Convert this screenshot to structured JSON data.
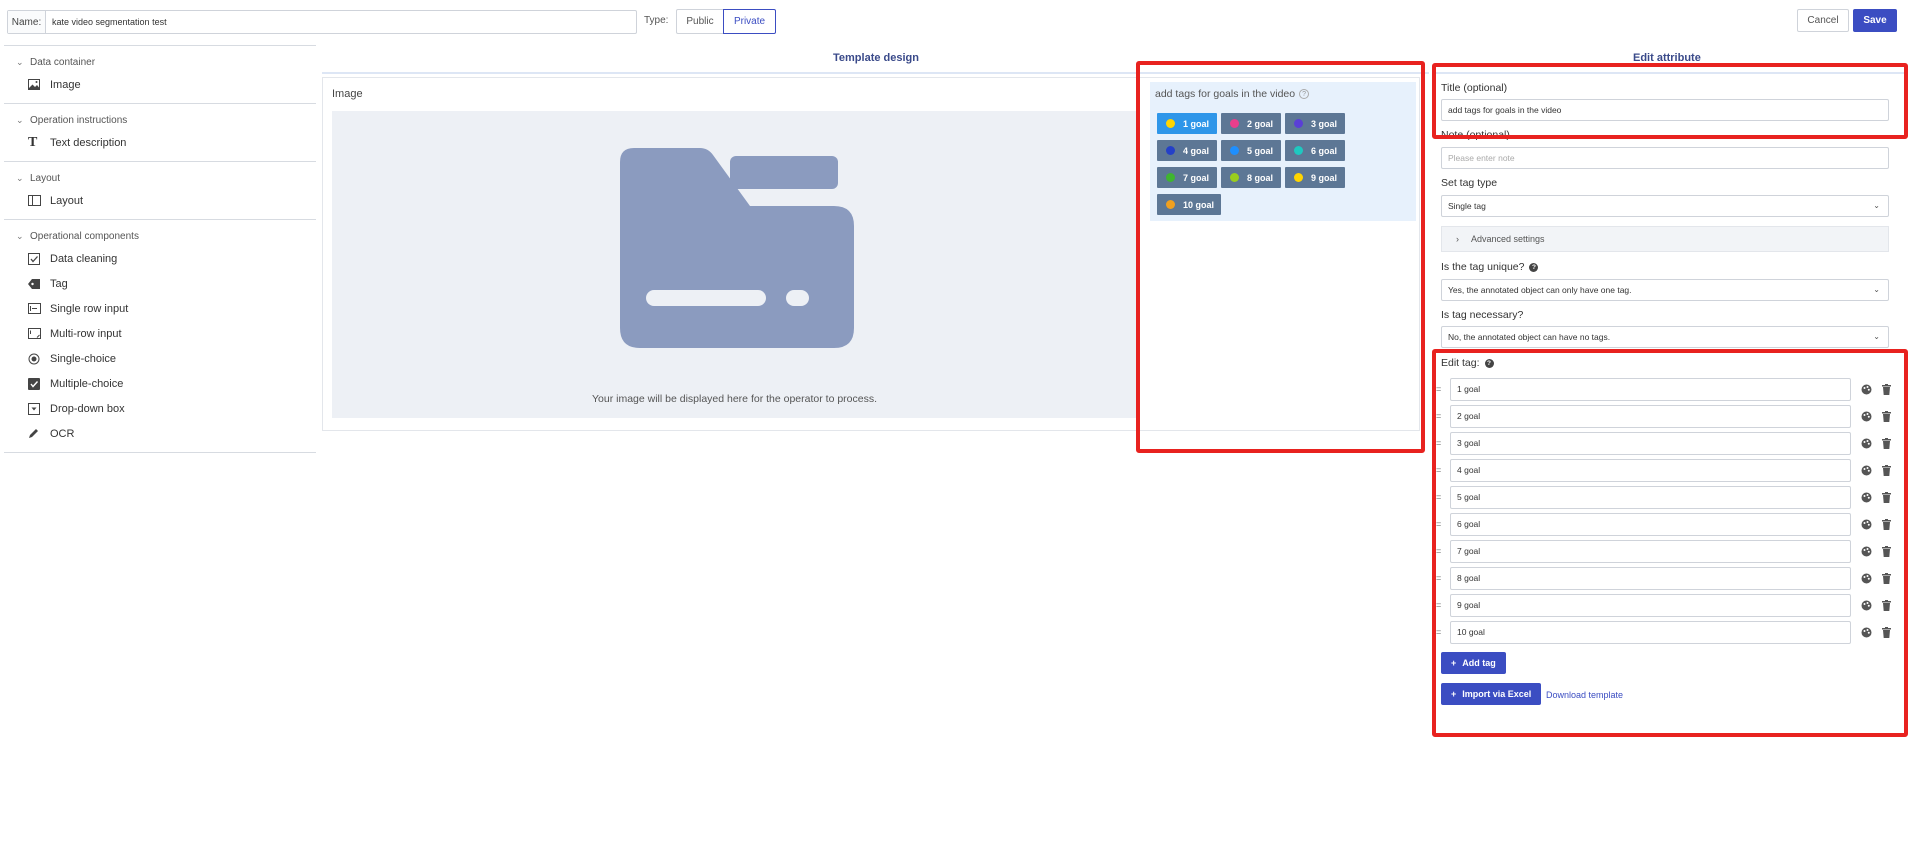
{
  "header": {
    "name_label": "Name:",
    "name_value": "kate video segmentation test",
    "type_label": "Type:",
    "type_options": [
      "Public",
      "Private"
    ],
    "type_selected": "Private",
    "cancel_label": "Cancel",
    "save_label": "Save"
  },
  "sidebar": {
    "sections": [
      {
        "title": "Data container",
        "items": [
          {
            "label": "Image",
            "icon": "image-icon"
          }
        ]
      },
      {
        "title": "Operation instructions",
        "items": [
          {
            "label": "Text description",
            "icon": "text-icon"
          }
        ]
      },
      {
        "title": "Layout",
        "items": [
          {
            "label": "Layout",
            "icon": "layout-icon"
          }
        ]
      },
      {
        "title": "Operational components",
        "items": [
          {
            "label": "Data cleaning",
            "icon": "checkbox-icon"
          },
          {
            "label": "Tag",
            "icon": "tag-icon"
          },
          {
            "label": "Single row input",
            "icon": "single-input-icon"
          },
          {
            "label": "Multi-row input",
            "icon": "multi-input-icon"
          },
          {
            "label": "Single-choice",
            "icon": "radio-icon"
          },
          {
            "label": "Multiple-choice",
            "icon": "checked-box-icon"
          },
          {
            "label": "Drop-down box",
            "icon": "dropdown-icon"
          },
          {
            "label": "OCR",
            "icon": "pen-icon"
          }
        ]
      }
    ]
  },
  "template_design": {
    "title": "Template design",
    "image_label": "Image",
    "image_caption": "Your image will be displayed here for the operator to process.",
    "tag_panel_title": "add tags for goals in the video",
    "tags": [
      {
        "label": "1 goal",
        "color": "#ffd500",
        "active": true
      },
      {
        "label": "2 goal",
        "color": "#e83e8c",
        "active": false
      },
      {
        "label": "3 goal",
        "color": "#5a3fd6",
        "active": false
      },
      {
        "label": "4 goal",
        "color": "#2440c8",
        "active": false
      },
      {
        "label": "5 goal",
        "color": "#1e8fff",
        "active": false
      },
      {
        "label": "6 goal",
        "color": "#1ec8c0",
        "active": false
      },
      {
        "label": "7 goal",
        "color": "#3fb52f",
        "active": false
      },
      {
        "label": "8 goal",
        "color": "#9acd1e",
        "active": false
      },
      {
        "label": "9 goal",
        "color": "#ffd500",
        "active": false
      },
      {
        "label": "10 goal",
        "color": "#f0a020",
        "active": false
      }
    ]
  },
  "edit_attribute": {
    "title": "Edit attribute",
    "title_label": "Title (optional)",
    "title_value": "add tags for goals in the video",
    "note_label": "Note (optional)",
    "note_placeholder": "Please enter note",
    "tag_type_label": "Set tag type",
    "tag_type_value": "Single tag",
    "advanced_label": "Advanced settings",
    "unique_label": "Is the tag unique?",
    "unique_value": "Yes, the annotated object can only have one tag.",
    "necessary_label": "Is tag necessary?",
    "necessary_value": "No, the annotated object can have no tags.",
    "edit_tag_label": "Edit tag:",
    "tag_values": [
      "1 goal",
      "2 goal",
      "3 goal",
      "4 goal",
      "5 goal",
      "6 goal",
      "7 goal",
      "8 goal",
      "9 goal",
      "10 goal"
    ],
    "add_tag_label": "Add tag",
    "import_label": "Import via Excel",
    "download_label": "Download template"
  }
}
